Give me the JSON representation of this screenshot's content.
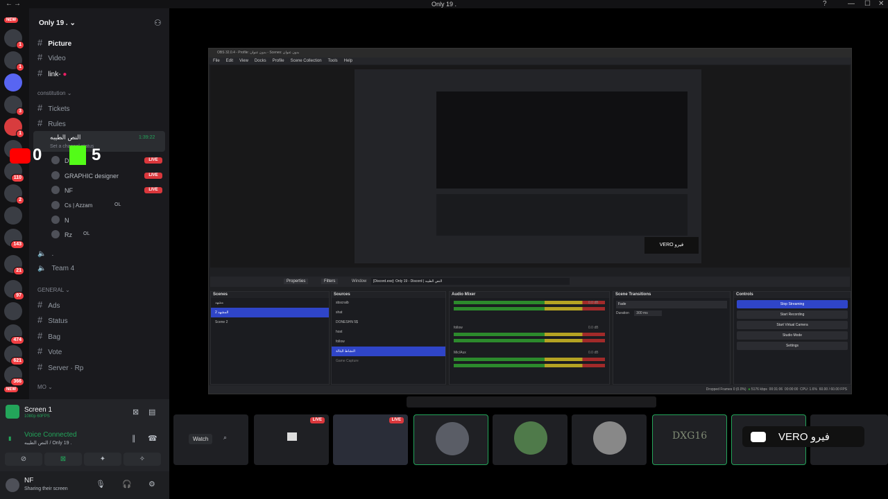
{
  "window": {
    "title": "Only 19 ."
  },
  "servers": {
    "badges": [
      "1",
      "1",
      "3",
      "1",
      "2",
      "110",
      "2",
      "143",
      "21",
      "97",
      "474",
      "621",
      "366"
    ],
    "new_label": "NEW"
  },
  "guild": {
    "name": "Only 19 ."
  },
  "channels": {
    "top": [
      {
        "label": "Picture"
      },
      {
        "label": "Video"
      },
      {
        "label": "link-"
      }
    ],
    "category1": "constitution",
    "cat1_items": [
      {
        "label": "Tickets"
      },
      {
        "label": "Rules"
      }
    ],
    "voice_channel": {
      "label": "النص الطيبه",
      "timer": "1:39:22",
      "status": "Set a channel status"
    },
    "voice_users": [
      {
        "name": "D",
        "live": "LIVE"
      },
      {
        "name": "GRAPHIC designer",
        "live": "LIVE"
      },
      {
        "name": "NF",
        "live": "LIVE"
      },
      {
        "name": "Cs | Azzam",
        "tag": "OL"
      },
      {
        "name": "N"
      },
      {
        "name": "Rz",
        "tag": "OL"
      }
    ],
    "other_voice": [
      {
        "label": "."
      },
      {
        "label": "Team 4"
      }
    ],
    "category2": "GENERAL",
    "cat2_items": [
      {
        "label": "Ads"
      },
      {
        "label": "Status"
      },
      {
        "label": "Bag"
      },
      {
        "label": "Vote"
      },
      {
        "label": "Server · Rp"
      }
    ],
    "category3": "MO"
  },
  "overlay": {
    "score_left": "0",
    "score_right": "5"
  },
  "stream_panel": {
    "title": "Screen 1",
    "quality": "1080p 60FPS",
    "voice_status": "Voice Connected",
    "voice_location": "النص الطيبه / Only 19 ."
  },
  "user_panel": {
    "name": "NF",
    "status": "Sharing their screen"
  },
  "obs": {
    "title": "OBS 32.0.4 - Profile: بدون عنوان - Scenes: بدون عنوان",
    "menu": [
      "File",
      "Edit",
      "View",
      "Docks",
      "Profile",
      "Scene Collection",
      "Tools",
      "Help"
    ],
    "source_bar": {
      "properties": "Properties",
      "filters": "Filters",
      "window_label": "Window",
      "window_value": "[Discord.exe]: Only 19 - Discord | النص الطيبه"
    },
    "scenes": {
      "title": "Scenes",
      "items": [
        "مشهد",
        "المشهد 2",
        "Scene 2"
      ]
    },
    "sources": {
      "title": "Sources",
      "items": [
        "sbscraib",
        "shat",
        "DONESHN 5$",
        "host",
        "follow",
        "النشاط البثالة",
        "Game Capture"
      ]
    },
    "mixer": {
      "title": "Audio Mixer",
      "tracks": [
        "",
        "follow",
        "Mic/Aux"
      ],
      "db": "0.0 dB"
    },
    "transitions": {
      "title": "Scene Transitions",
      "type": "Fade",
      "duration_label": "Duration",
      "duration_value": "300 ms"
    },
    "controls": {
      "title": "Controls",
      "buttons": [
        "Stop Streaming",
        "Start Recording",
        "Start Virtual Camera",
        "Studio Mode",
        "Settings"
      ]
    },
    "status": {
      "dropped": "Dropped Frames 0 (0.0%)",
      "bitrate": "5176 kbps",
      "time1": "00:31:06",
      "time2": "00:00:00",
      "cpu": "CPU: 1.6%",
      "fps": "60.00 / 60.00 FPS"
    }
  },
  "stream_tiles": {
    "watch": "Watch",
    "live": "LIVE",
    "dxg_label": "DXG16",
    "vero_label": "VERO فيرو"
  }
}
